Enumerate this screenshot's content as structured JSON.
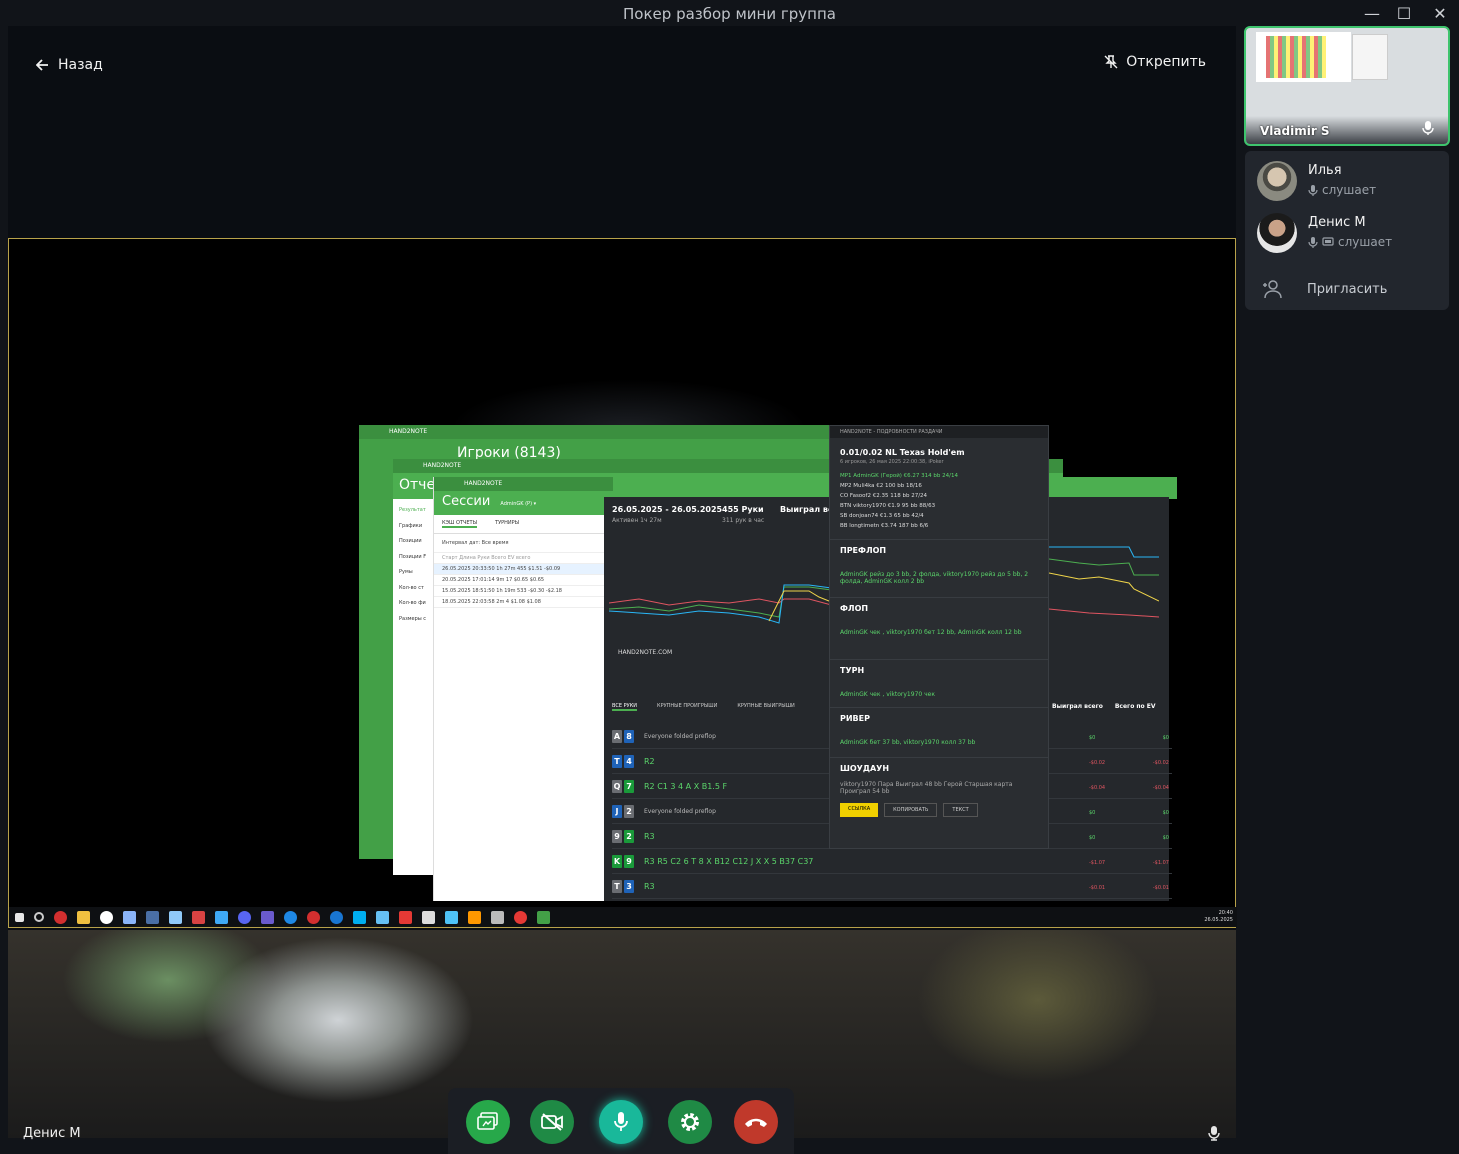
{
  "window": {
    "title": "Покер разбор мини группа",
    "minimize": "—",
    "maximize": "☐",
    "close": "✕"
  },
  "stage": {
    "back_label": "Назад",
    "unpin_label": "Открепить",
    "local_user_name": "Денис М"
  },
  "sidebar": {
    "screen_owner": "Vladimir S",
    "participants": [
      {
        "name": "Илья",
        "status": "слушает"
      },
      {
        "name": "Денис М",
        "status": "слушает"
      }
    ],
    "invite_label": "Пригласить"
  },
  "shared_screen": {
    "app_name": "HAND2NOTE",
    "players_title": "Игроки (8143)",
    "reports_title": "Отче",
    "sessions_title": "Сессии",
    "sessions_user": "AdminGK (P) ▾",
    "sessions_tabs": [
      "КЭШ ОТЧЕТЫ",
      "ТУРНИРЫ"
    ],
    "interval_label": "Интервал дат: Все время",
    "sessions_header": "Старт   Длина  Руки  Всего  EV всего",
    "sessions_rows": [
      "26.05.2025 20:33:50   1h 27m   455   $1.51   -$0.09",
      "20.05.2025 17:01:14   9m   17   $0.65   $0.65",
      "15.05.2025 18:51:50   1h 19m   533   -$0.30   -$2.18",
      "18.05.2025 22:03:58   2m   4   $1.08   $1.08"
    ],
    "reports_menu": [
      "Результат",
      "Графики",
      "Позиции",
      "Позиции F",
      "Румы",
      "Кол-во ст",
      "Кол-во фи",
      "Размеры с"
    ],
    "period": "26.05.2025 - 26.05.2025",
    "hands_count": "455 Руки",
    "won_total": "Выиграл все",
    "active_time": "Активен 1ч 27м",
    "hands_per_hour": "311 рук в час",
    "watermark": "HAND2NOTE.COM",
    "hand_tabs": [
      "ВСЕ РУКИ",
      "КРУПНЫЕ ПРОИГРЫШИ",
      "КРУПНЫЕ ВЫИГРЫШИ"
    ],
    "right_headers": [
      "Выиграл всего",
      "Всего по EV"
    ],
    "hands": [
      {
        "c1": "A",
        "c2": "8",
        "c1c": "c-gray",
        "c2c": "c-blue",
        "action": "Everyone folded preflop",
        "val": "$0",
        "ev": "$0"
      },
      {
        "c1": "T",
        "c2": "4",
        "c1c": "c-blue",
        "c2c": "c-blue",
        "action": "R2",
        "val": "-$0.02",
        "ev": "-$0.02"
      },
      {
        "c1": "Q",
        "c2": "7",
        "c1c": "c-gray",
        "c2c": "c-green",
        "action": "R2 C1   3 4 A   X B1.5 F",
        "val": "-$0.04",
        "ev": "-$0.04"
      },
      {
        "c1": "J",
        "c2": "2",
        "c1c": "c-blue",
        "c2c": "c-gray",
        "action": "Everyone folded preflop",
        "val": "$0",
        "ev": "$0"
      },
      {
        "c1": "9",
        "c2": "2",
        "c1c": "c-gray",
        "c2c": "c-green",
        "action": "R3",
        "val": "$0",
        "ev": "$0"
      },
      {
        "c1": "K",
        "c2": "9",
        "c1c": "c-green",
        "c2c": "c-green",
        "action": "R3 R5 C2   6 T 8   X B12 C12   J   X X   5   B37 C37",
        "val": "-$1.07",
        "ev": "-$1.07"
      },
      {
        "c1": "T",
        "c2": "3",
        "c1c": "c-gray",
        "c2c": "c-blue",
        "action": "R3",
        "val": "-$0.01",
        "ev": "-$0.01"
      }
    ],
    "popup": {
      "header": "HAND2NOTE - ПОДРОБНОСТИ РАЗДАЧИ",
      "title": "0.01/0.02 NL Texas Hold'em",
      "subtitle": "6 игроков, 26 мая 2025 22:00:38, iPoker",
      "seats": [
        "MP1  AdminGK (Герой)   €6.27  314 bb  24/14",
        "MP2  Muli4ka   €2   100 bb  18/16",
        "CO   Fasoof2   €2.35  118 bb  27/24",
        "BTN  viktory1970   €1.9   95 bb  88/63",
        "SB   donjoan74   €1.3   65 bb  42/4",
        "BB   longtimetn   €3.74  187 bb  6/6"
      ],
      "streets": [
        {
          "name": "ПРЕФЛОП",
          "action": "AdminGK рейз до 3 bb, 2 фолда, viktory1970 рейз до 5 bb, 2 фолда, AdminGK колл 2 bb"
        },
        {
          "name": "ФЛОП",
          "action": "AdminGK чек , viktory1970 бет 12 bb, AdminGK колл 12 bb"
        },
        {
          "name": "ТУРН",
          "action": "AdminGK чек , viktory1970 чек"
        },
        {
          "name": "РИВЕР",
          "action": "AdminGK бет 37 bb, viktory1970 колл 37 bb"
        },
        {
          "name": "ШОУДАУН",
          "action": "viktory1970 Пара Выиграл 48 bb   Герой Старшая карта Проиграл 54 bb"
        }
      ],
      "buttons": [
        "ССЫЛКА",
        "КОПИРОВАТЬ",
        "ТЕКСТ"
      ]
    },
    "clock_time": "20:40",
    "clock_date": "26.05.2025"
  },
  "colors": {
    "accent_green": "#3ec46d",
    "hand2note_green": "#4caf50",
    "hangup_red": "#c0392b",
    "mic_teal": "#19b89a"
  }
}
